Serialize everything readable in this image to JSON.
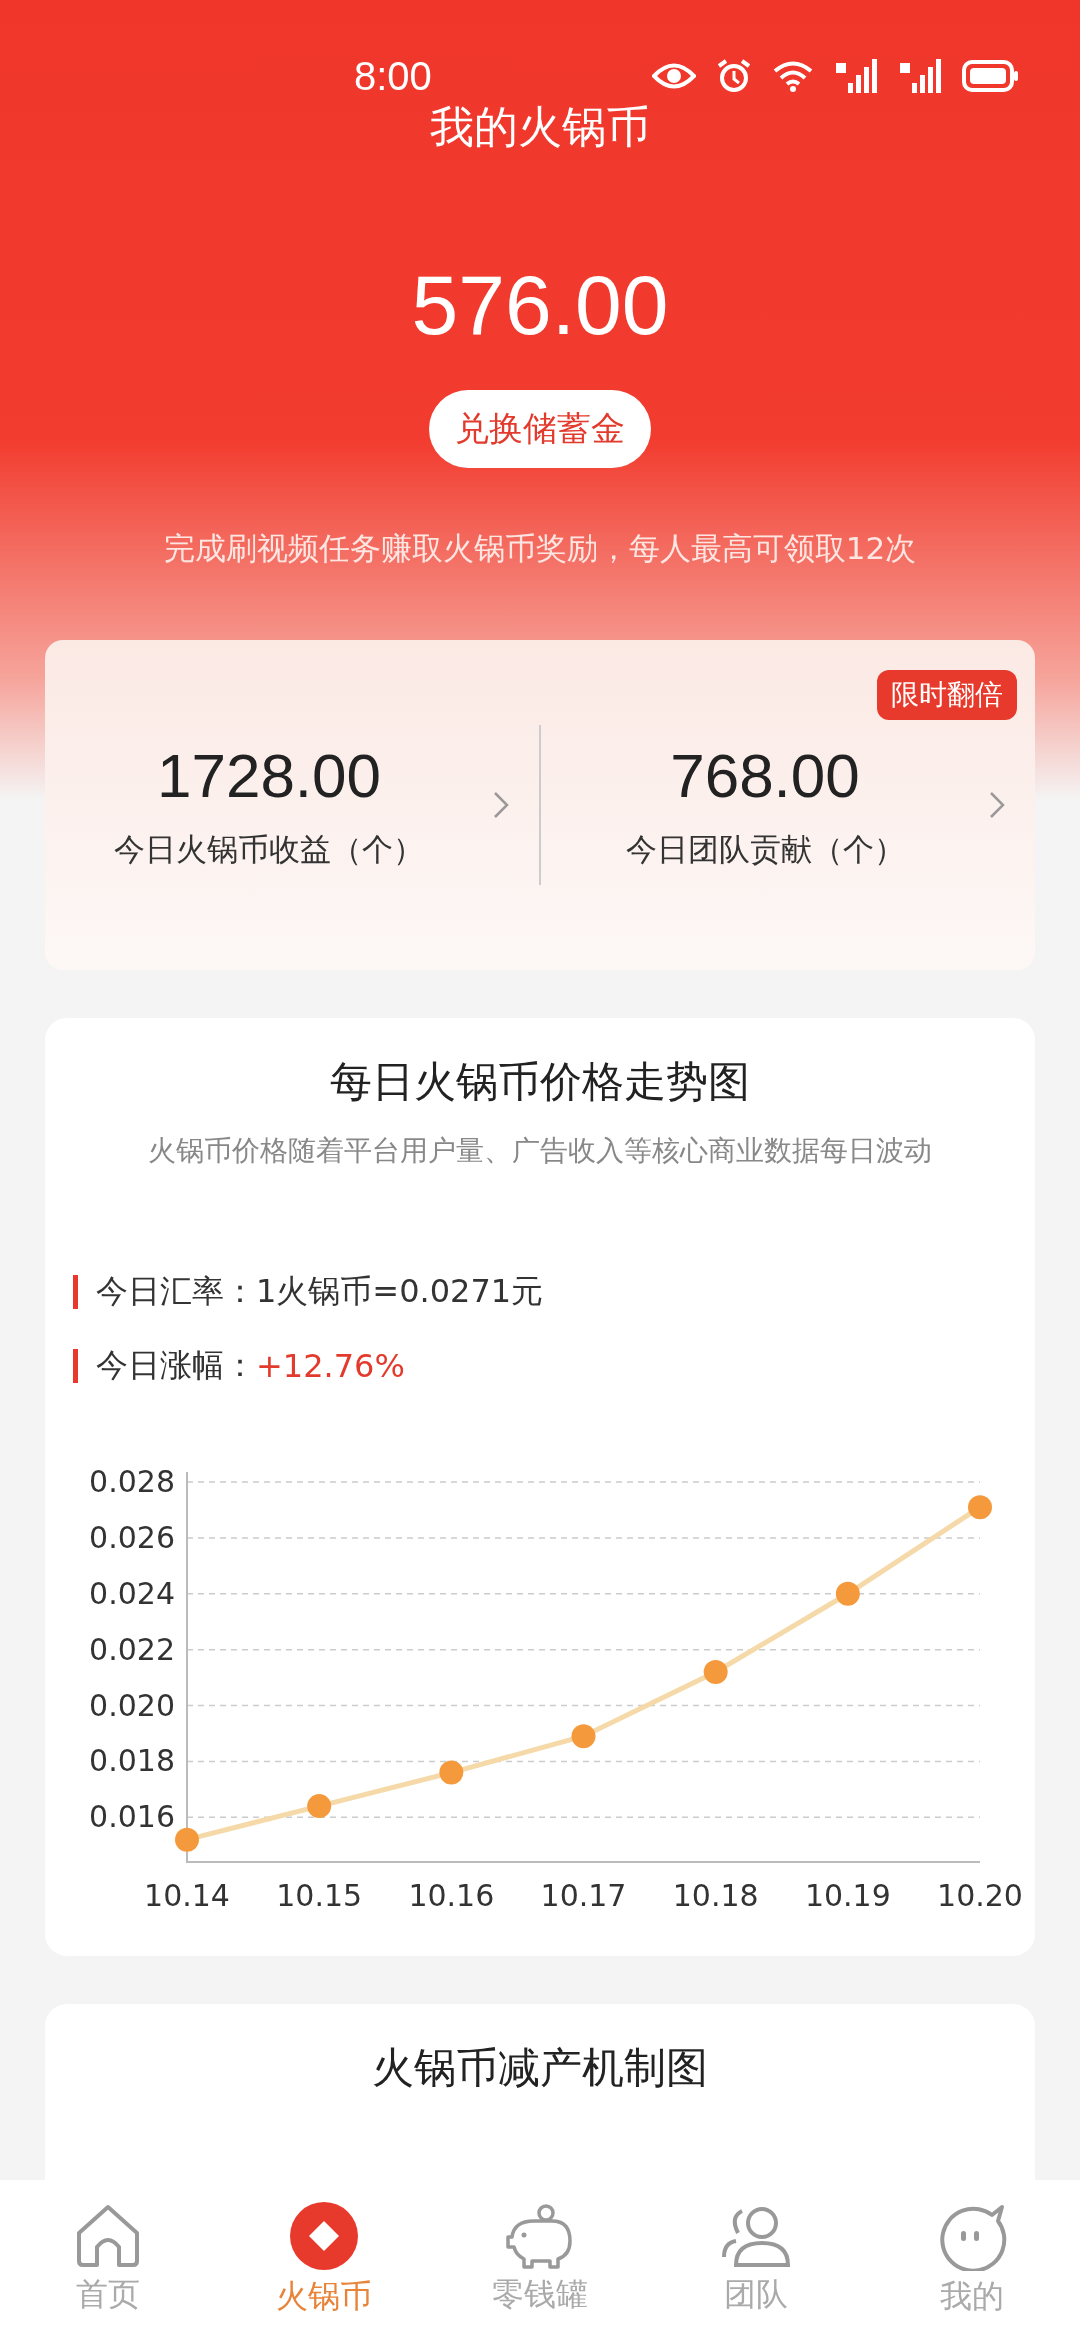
{
  "status_bar": {
    "time": "8:00"
  },
  "header": {
    "title": "我的火锅币",
    "balance": "576.00",
    "button": "兑换储蓄金",
    "note": "完成刷视频任务赚取火锅币奖励，每人最高可领取12次"
  },
  "stats": {
    "badge": "限时翻倍",
    "items": [
      {
        "value": "1728.00",
        "label": "今日火锅币收益（个）"
      },
      {
        "value": "768.00",
        "label": "今日团队贡献（个）"
      }
    ]
  },
  "price_card": {
    "title": "每日火锅币价格走势图",
    "description": "火锅币价格随着平台用户量、广告收入等核心商业数据每日波动",
    "facts": [
      {
        "label": "今日汇率：",
        "value": "1火锅币=0.0271元",
        "kind": "plain"
      },
      {
        "label": "今日涨幅：",
        "value": "+12.76%",
        "kind": "rise"
      }
    ],
    "chart_data": {
      "type": "line",
      "categories": [
        "10.14",
        "10.15",
        "10.16",
        "10.17",
        "10.18",
        "10.19",
        "10.20"
      ],
      "grid": true,
      "series": [
        {
          "color": "#f59a3c",
          "marker": true,
          "values": [
            0.0152,
            0.0164,
            0.0176,
            0.0189,
            0.0212,
            0.024,
            0.0271
          ]
        }
      ],
      "ylim": [
        0.0144,
        0.028
      ],
      "yticks": [
        {
          "value": 0.016,
          "label": "0.016"
        },
        {
          "value": 0.018,
          "label": "0.018"
        },
        {
          "value": 0.02,
          "label": "0.020"
        },
        {
          "value": 0.022,
          "label": "0.022"
        },
        {
          "value": 0.024,
          "label": "0.024"
        },
        {
          "value": 0.026,
          "label": "0.026"
        },
        {
          "value": 0.028,
          "label": "0.028"
        }
      ]
    }
  },
  "next_card": {
    "title": "火锅币减产机制图"
  },
  "tab_bar": [
    {
      "label": "首页",
      "kind": "home",
      "selected": false
    },
    {
      "label": "火锅币",
      "kind": "coin",
      "selected": true
    },
    {
      "label": "零钱罐",
      "kind": "piggy",
      "selected": false
    },
    {
      "label": "团队",
      "kind": "team",
      "selected": false
    },
    {
      "label": "我的",
      "kind": "me",
      "selected": false
    }
  ]
}
